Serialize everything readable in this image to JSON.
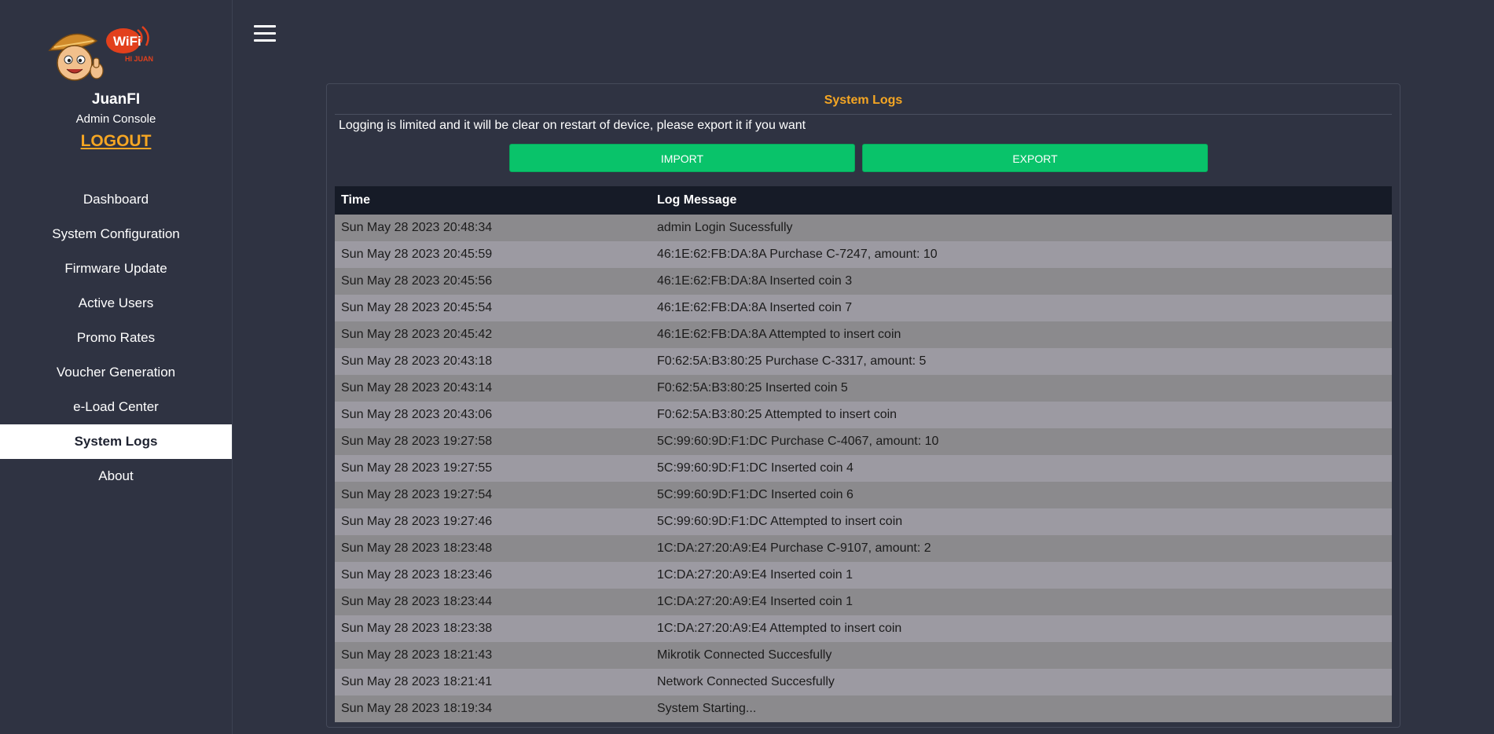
{
  "app": {
    "brand": "JuanFI",
    "subtitle": "Admin Console",
    "logout_label": "LOGOUT",
    "logo_text": "WiFi",
    "logo_sub": "HI JUAN"
  },
  "nav": {
    "items": [
      {
        "label": "Dashboard"
      },
      {
        "label": "System Configuration"
      },
      {
        "label": "Firmware Update"
      },
      {
        "label": "Active Users"
      },
      {
        "label": "Promo Rates"
      },
      {
        "label": "Voucher Generation"
      },
      {
        "label": "e-Load Center"
      },
      {
        "label": "System Logs",
        "active": true
      },
      {
        "label": "About"
      }
    ]
  },
  "panel": {
    "title": "System Logs",
    "note": "Logging is limited and it will be clear on restart of device, please export it if you want",
    "import_label": "IMPORT",
    "export_label": "EXPORT"
  },
  "table": {
    "headers": [
      "Time",
      "Log Message"
    ],
    "rows": [
      [
        "Sun May 28 2023 20:48:34",
        "admin Login Sucessfully"
      ],
      [
        "Sun May 28 2023 20:45:59",
        "46:1E:62:FB:DA:8A Purchase C-7247, amount: 10"
      ],
      [
        "Sun May 28 2023 20:45:56",
        "46:1E:62:FB:DA:8A Inserted coin 3"
      ],
      [
        "Sun May 28 2023 20:45:54",
        "46:1E:62:FB:DA:8A Inserted coin 7"
      ],
      [
        "Sun May 28 2023 20:45:42",
        "46:1E:62:FB:DA:8A Attempted to insert coin"
      ],
      [
        "Sun May 28 2023 20:43:18",
        "F0:62:5A:B3:80:25 Purchase C-3317, amount: 5"
      ],
      [
        "Sun May 28 2023 20:43:14",
        "F0:62:5A:B3:80:25 Inserted coin 5"
      ],
      [
        "Sun May 28 2023 20:43:06",
        "F0:62:5A:B3:80:25 Attempted to insert coin"
      ],
      [
        "Sun May 28 2023 19:27:58",
        "5C:99:60:9D:F1:DC Purchase C-4067, amount: 10"
      ],
      [
        "Sun May 28 2023 19:27:55",
        "5C:99:60:9D:F1:DC Inserted coin 4"
      ],
      [
        "Sun May 28 2023 19:27:54",
        "5C:99:60:9D:F1:DC Inserted coin 6"
      ],
      [
        "Sun May 28 2023 19:27:46",
        "5C:99:60:9D:F1:DC Attempted to insert coin"
      ],
      [
        "Sun May 28 2023 18:23:48",
        "1C:DA:27:20:A9:E4 Purchase C-9107, amount: 2"
      ],
      [
        "Sun May 28 2023 18:23:46",
        "1C:DA:27:20:A9:E4 Inserted coin 1"
      ],
      [
        "Sun May 28 2023 18:23:44",
        "1C:DA:27:20:A9:E4 Inserted coin 1"
      ],
      [
        "Sun May 28 2023 18:23:38",
        "1C:DA:27:20:A9:E4 Attempted to insert coin"
      ],
      [
        "Sun May 28 2023 18:21:43",
        "Mikrotik Connected Succesfully"
      ],
      [
        "Sun May 28 2023 18:21:41",
        "Network Connected Succesfully"
      ],
      [
        "Sun May 28 2023 18:19:34",
        "System Starting..."
      ]
    ]
  },
  "colors": {
    "background": "#2f3342",
    "accent": "#f5a623",
    "button": "#09c36a",
    "header_row": "#161b27",
    "row_odd": "#8b8a8d",
    "row_even": "#9c9aa2"
  },
  "icons": {
    "menu": "hamburger-menu-icon"
  }
}
